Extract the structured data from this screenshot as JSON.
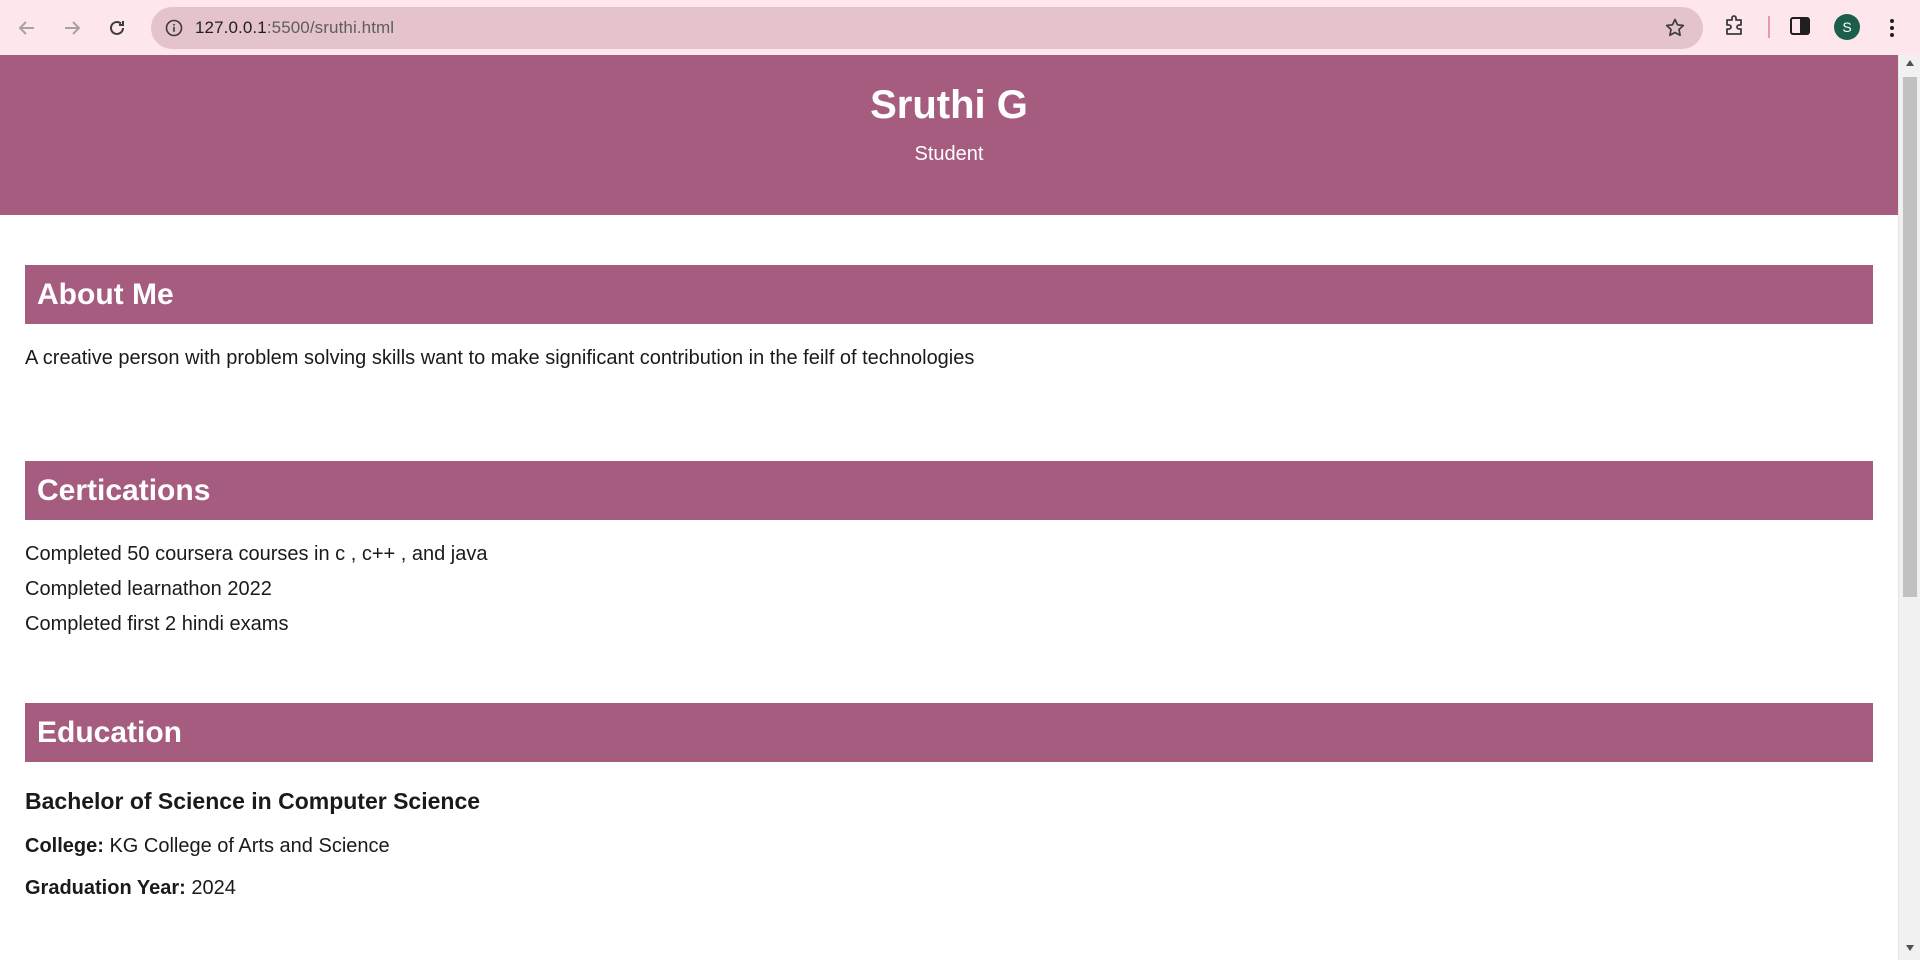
{
  "browser": {
    "url_host": "127.0.0.1",
    "url_path": ":5500/sruthi.html",
    "profile_initial": "S",
    "icons": [
      "back-arrow-icon",
      "forward-arrow-icon",
      "reload-icon",
      "site-info-icon",
      "star-icon",
      "extensions-icon",
      "side-panel-icon",
      "kebab-menu-icon"
    ]
  },
  "header": {
    "name": "Sruthi G",
    "role": "Student"
  },
  "about": {
    "title": "About Me",
    "text": "A creative person with problem solving skills want to make significant contribution in the feilf of technologies"
  },
  "certifications": {
    "title": "Certications",
    "items": [
      "Completed 50 coursera courses in c , c++ , and java",
      "Completed learnathon 2022",
      "Completed first 2 hindi exams"
    ]
  },
  "education": {
    "title": "Education",
    "degree": "Bachelor of Science in Computer Science",
    "college_label": "College:",
    "college_value": "KG College of Arts and Science",
    "year_label": "Graduation Year:",
    "year_value": "2024"
  },
  "colors": {
    "accent": "#a65c7e",
    "chrome_bg": "#fde7ec",
    "omnibox_bg": "#e4c4ca",
    "avatar_bg": "#1b5e4b"
  }
}
